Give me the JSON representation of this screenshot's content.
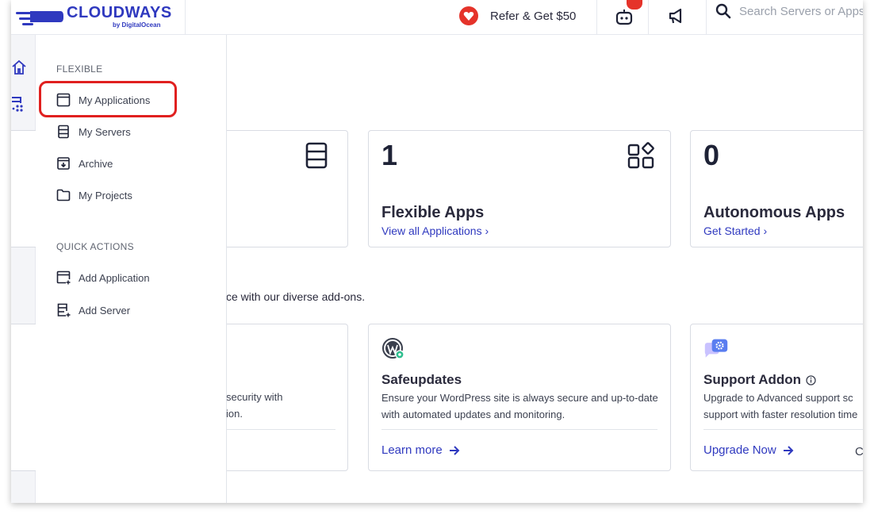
{
  "brand": {
    "name": "CLOUDWAYS",
    "by": "by DigitalOcean",
    "primary_color": "#2f39bf",
    "highlight_color": "#e0201f"
  },
  "topbar": {
    "refer_label": "Refer & Get $50",
    "search_placeholder": "Search Servers or Apps"
  },
  "flyout": {
    "flexible_title": "FLEXIBLE",
    "flexible_items": [
      {
        "label": "My Applications",
        "icon": "window-icon"
      },
      {
        "label": "My Servers",
        "icon": "server-icon"
      },
      {
        "label": "Archive",
        "icon": "archive-icon"
      },
      {
        "label": "My Projects",
        "icon": "folder-icon"
      }
    ],
    "quick_title": "QUICK ACTIONS",
    "quick_items": [
      {
        "label": "Add Application",
        "icon": "add-window-icon"
      },
      {
        "label": "Add Server",
        "icon": "add-server-icon"
      }
    ]
  },
  "stats": [
    {
      "number": "1",
      "title": "Flexible Apps",
      "link": "View all Applications ›"
    },
    {
      "number": "0",
      "title": "Autonomous Apps",
      "link": "Get Started ›"
    }
  ],
  "addons_intro": "ce with our diverse add-ons.",
  "addons": [
    {
      "partial_lines": [
        "security with",
        "ion."
      ]
    },
    {
      "title": "Safeupdates",
      "desc": "Ensure your WordPress site is always secure and up-to-date with automated updates and monitoring.",
      "link": "Learn more"
    },
    {
      "title": "Support Addon",
      "desc": "Upgrade to Advanced support sc support with faster resolution time",
      "link": "Upgrade Now",
      "trailing": "C"
    }
  ]
}
